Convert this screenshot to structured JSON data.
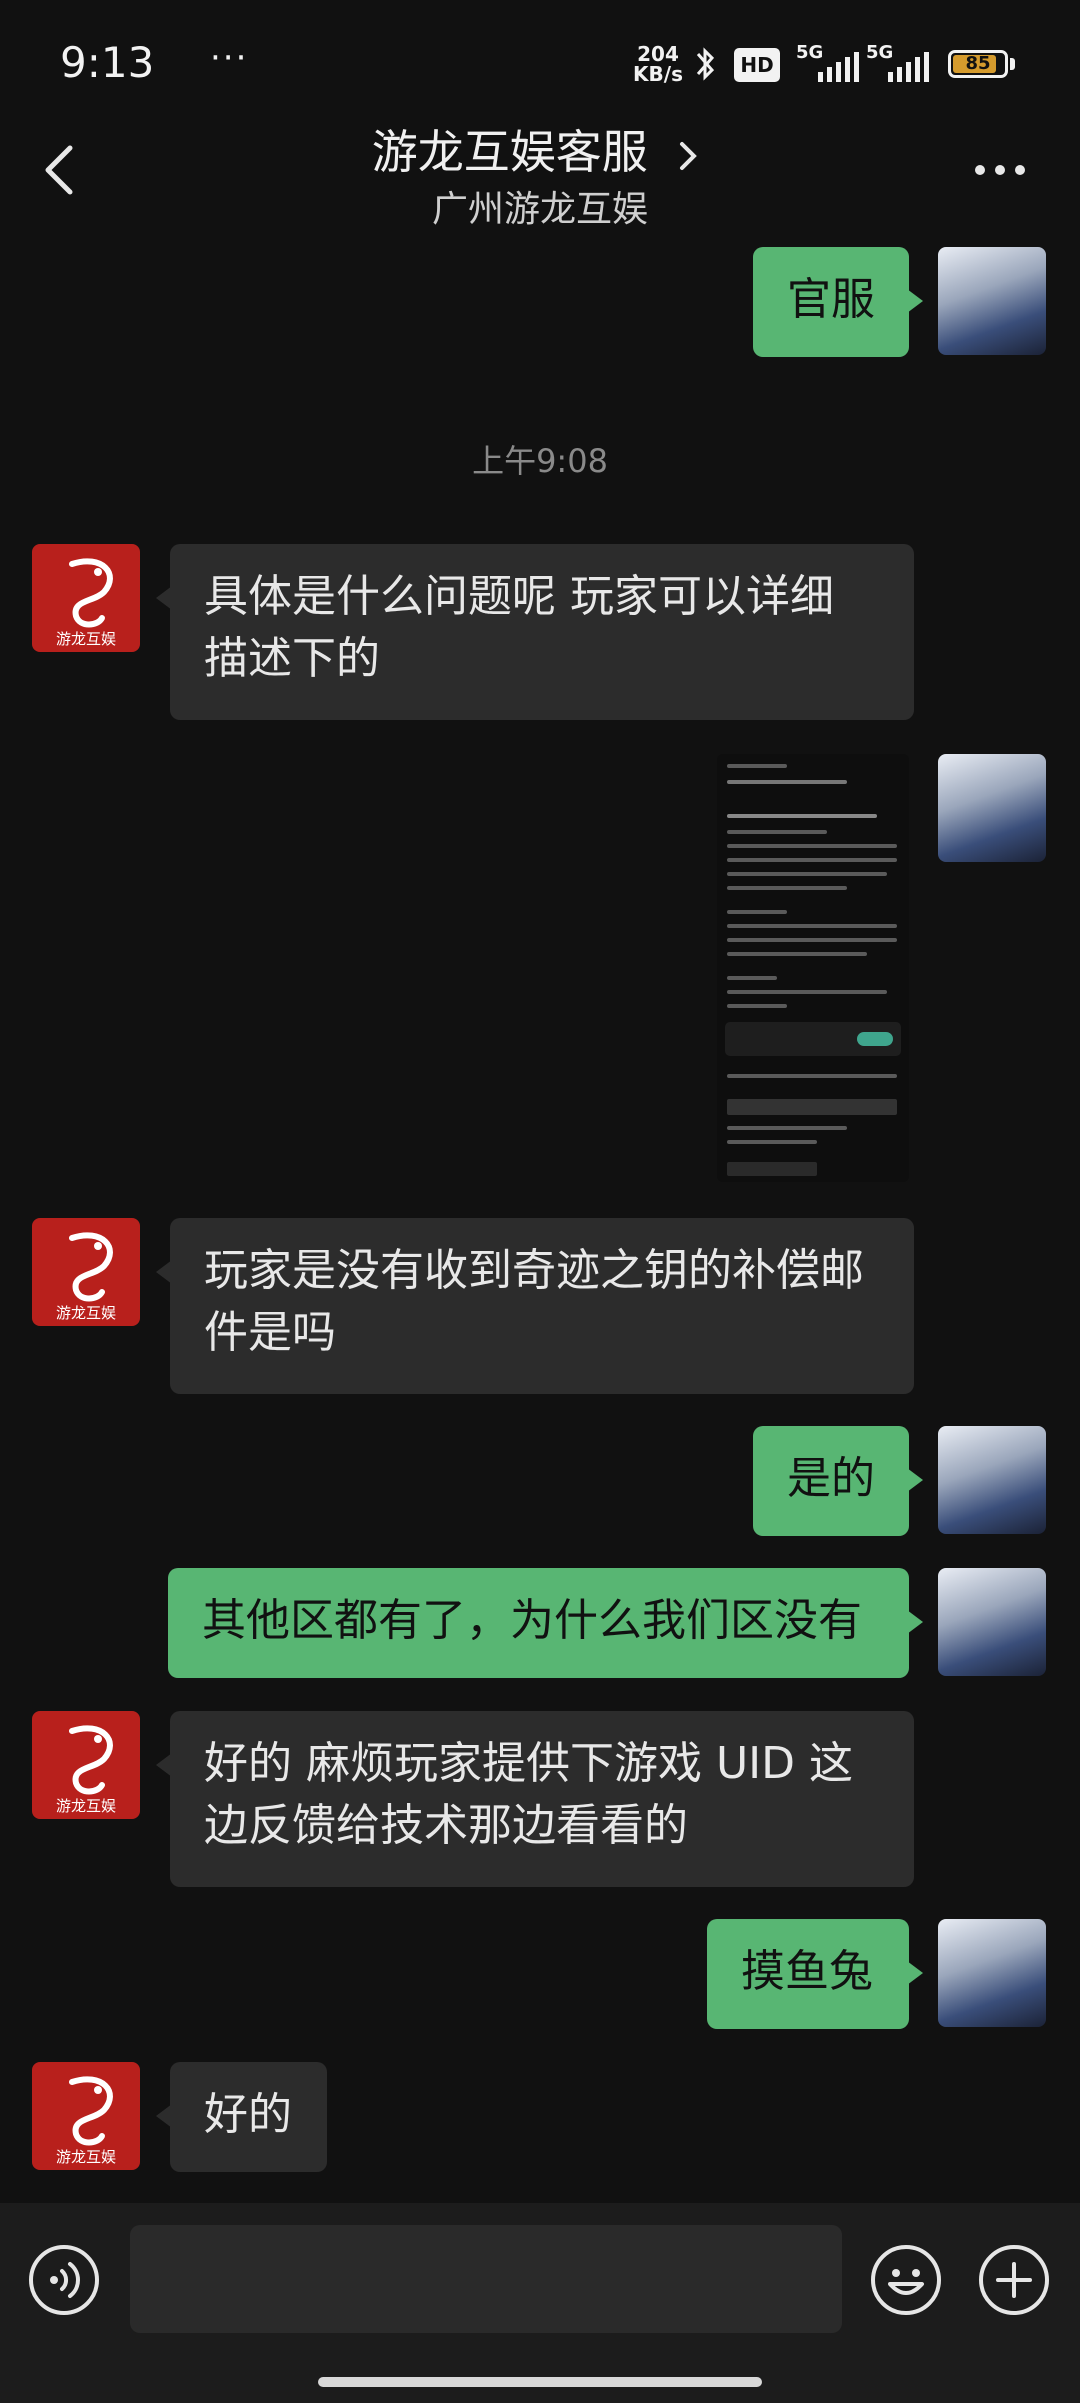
{
  "status_bar": {
    "time": "9:13",
    "dots": "···",
    "net_speed_value": "204",
    "net_speed_unit": "KB/s",
    "hd_badge": "HD",
    "signal_1_label": "5G",
    "signal_2_label": "5G",
    "battery": "85",
    "battery_level": 0.85,
    "battery_color": "#d59b2d"
  },
  "header": {
    "title": "游龙互娱客服",
    "subtitle": "广州游龙互娱",
    "back_icon": "chevron-left-icon",
    "more_icon": "more-horizontal-icon"
  },
  "messages": [
    {
      "from": "user",
      "text": "官服"
    },
    {
      "timestamp": "上午9:08"
    },
    {
      "from": "agent",
      "text": "具体是什么问题呢 玩家可以详细描述下的",
      "line1": "具体是什么问题呢 玩家可以详细",
      "line2": "描述下的"
    },
    {
      "from": "user",
      "type": "image",
      "image_desc": "screenshot"
    },
    {
      "from": "agent",
      "text": "玩家是没有收到奇迹之钥的补偿邮件是吗",
      "line1": "玩家是没有收到奇迹之钥的补偿邮",
      "line2": "件是吗"
    },
    {
      "from": "user",
      "text": "是的"
    },
    {
      "from": "user",
      "text": "其他区都有了，为什么我们区没有"
    },
    {
      "from": "agent",
      "text": "好的 麻烦玩家提供下游戏 UID 这边反馈给技术那边看看的",
      "line1": "好的 麻烦玩家提供下游戏 UID 这",
      "line2": "边反馈给技术那边看看的"
    },
    {
      "from": "user",
      "text": "摸鱼兔"
    },
    {
      "from": "agent",
      "text": "好的"
    }
  ],
  "agent_avatar_text": "游龙互娱",
  "input_bar": {
    "voice_icon": "voice-icon",
    "emoji_icon": "emoji-icon",
    "plus_icon": "plus-icon"
  },
  "colors": {
    "background": "#111111",
    "outgoing_bubble": "#58b673",
    "incoming_bubble": "#2c2c2c",
    "brand_red": "#b8201c"
  }
}
